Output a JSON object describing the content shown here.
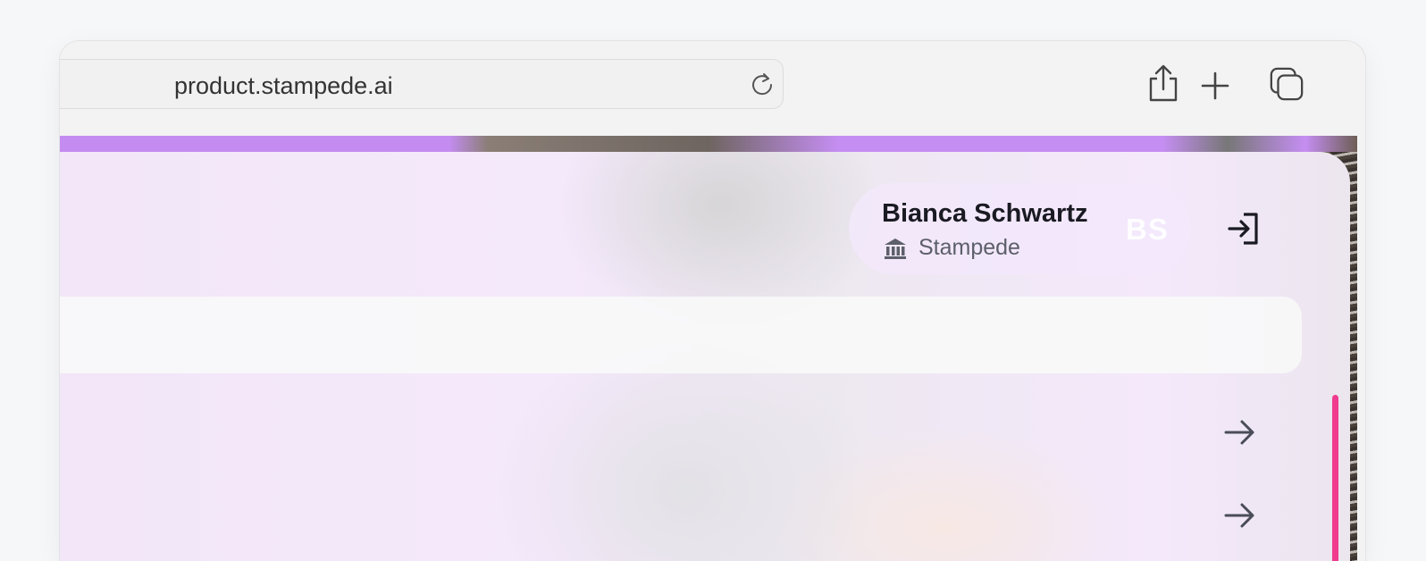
{
  "browser": {
    "url": "product.stampede.ai",
    "icons": [
      "reload-icon",
      "share-icon",
      "new-tab-icon",
      "tabs-overview-icon"
    ]
  },
  "user": {
    "name": "Bianca Schwartz",
    "organization": "Stampede",
    "initials": "BS",
    "org_icon": "bank-icon"
  },
  "actions": {
    "login_icon": "login-icon",
    "row_arrows": [
      "arrow-right-icon",
      "arrow-right-icon"
    ]
  },
  "colors": {
    "accent": "#ef3c8e",
    "strip": "#c48cf0",
    "panel_tint": "#f3e8fb"
  }
}
